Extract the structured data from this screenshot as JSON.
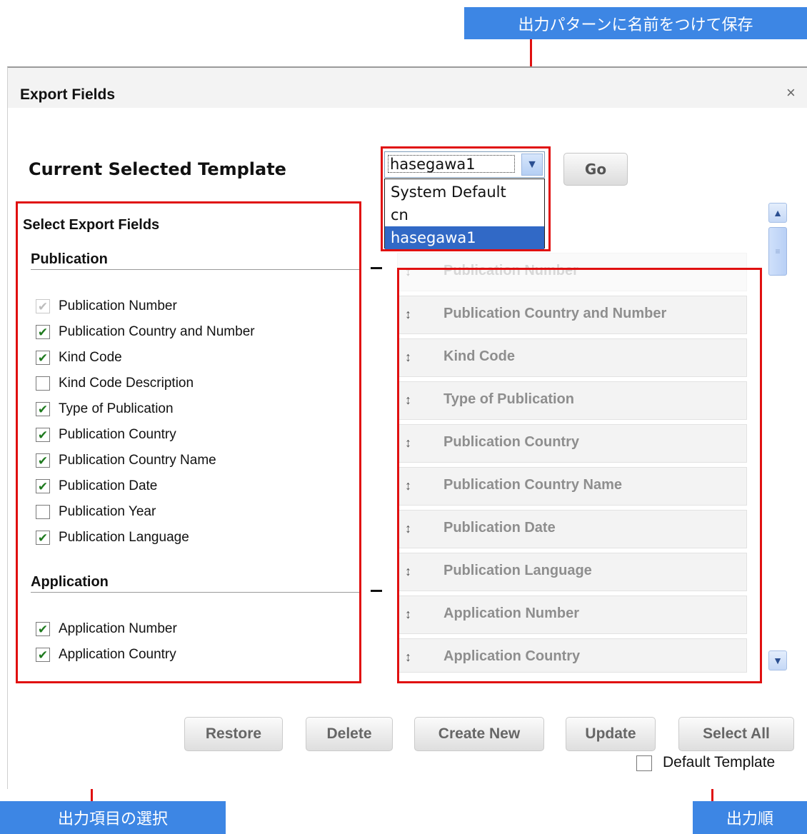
{
  "callouts": {
    "save_pattern": "出力パターンに名前をつけて保存",
    "select_fields": "出力項目の選択",
    "output_order": "出力順"
  },
  "dialog": {
    "title": "Export Fields",
    "close": "×"
  },
  "template": {
    "label": "Current Selected Template",
    "selected": "hasegawa1",
    "options": [
      "System Default",
      "cn",
      "hasegawa1"
    ],
    "go": "Go"
  },
  "fields": {
    "title": "Select Export Fields",
    "groups": [
      {
        "name": "Publication",
        "items": [
          {
            "label": "Publication Number",
            "checked": true,
            "disabled": true
          },
          {
            "label": "Publication Country and Number",
            "checked": true
          },
          {
            "label": "Kind Code",
            "checked": true
          },
          {
            "label": "Kind Code Description",
            "checked": false
          },
          {
            "label": "Type of Publication",
            "checked": true
          },
          {
            "label": "Publication Country",
            "checked": true
          },
          {
            "label": "Publication Country Name",
            "checked": true
          },
          {
            "label": "Publication Date",
            "checked": true
          },
          {
            "label": "Publication Year",
            "checked": false
          },
          {
            "label": "Publication Language",
            "checked": true
          }
        ]
      },
      {
        "name": "Application",
        "items": [
          {
            "label": "Application Number",
            "checked": true
          },
          {
            "label": "Application Country",
            "checked": true
          }
        ]
      }
    ]
  },
  "order": [
    "Publication Number",
    "Publication Country and Number",
    "Kind Code",
    "Type of Publication",
    "Publication Country",
    "Publication Country Name",
    "Publication Date",
    "Publication Language",
    "Application Number",
    "Application Country"
  ],
  "buttons": {
    "restore": "Restore",
    "delete": "Delete",
    "create_new": "Create New",
    "update": "Update",
    "select_all": "Select All"
  },
  "default_template": {
    "label": "Default Template",
    "checked": false
  },
  "colors": {
    "callout": "#3d86e4",
    "highlight": "#e01010",
    "selected_option": "#3169c6"
  },
  "icons": {
    "drag_handle": "↕",
    "check": "✔",
    "dropdown": "chevron-down"
  }
}
